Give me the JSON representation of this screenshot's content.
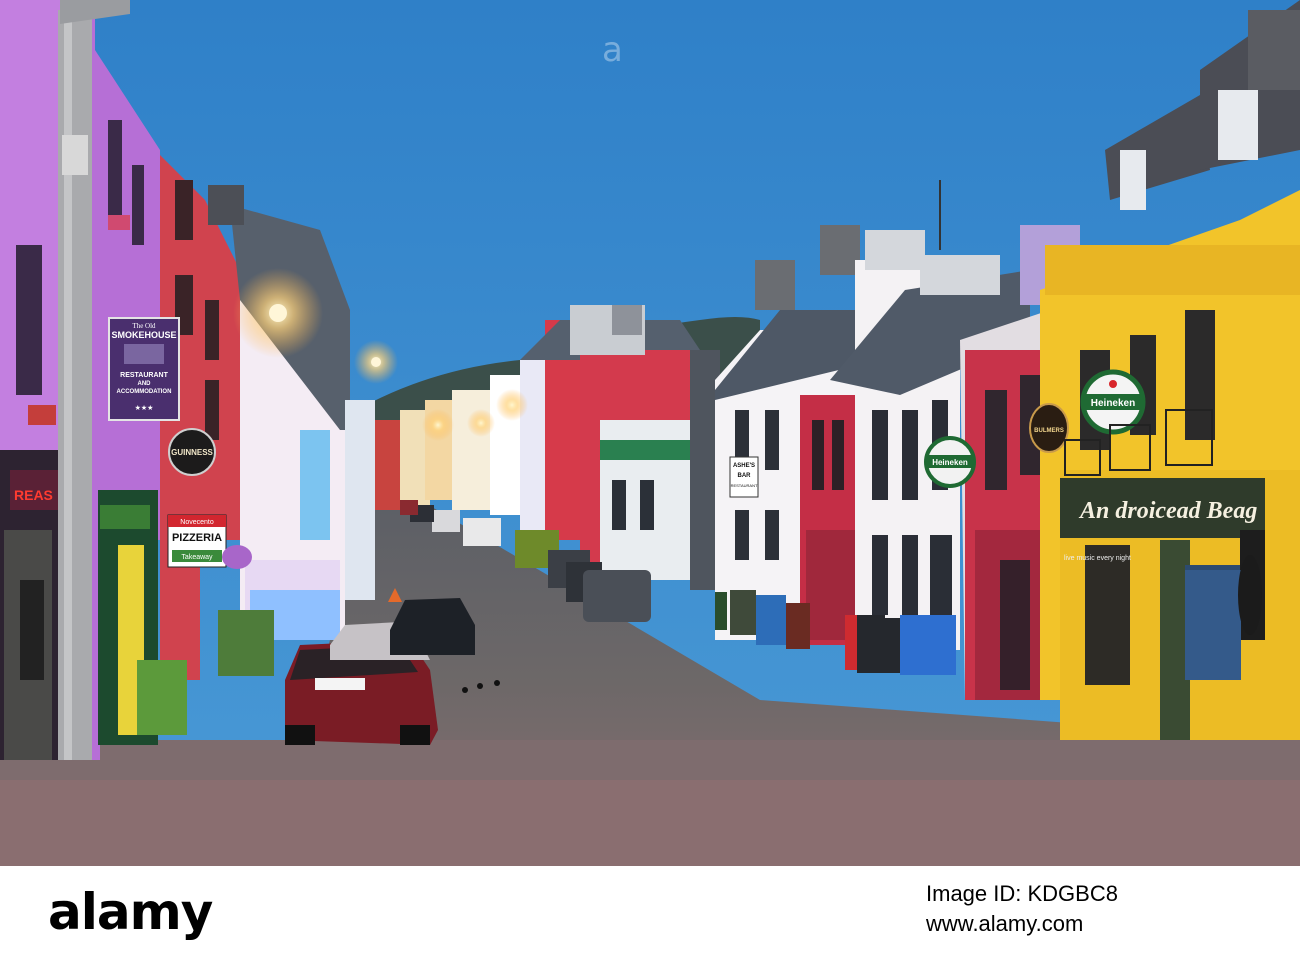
{
  "photo": {
    "subject": "Dingle Main Street",
    "colors": {
      "sky": "#3f8fd1",
      "road": "#6e6a6a",
      "yellow_pub": "#f0c229",
      "purple_building": "#b06ad0"
    }
  },
  "signs": {
    "smokehouse_top": "The Old",
    "smokehouse_name": "SMOKEHOUSE",
    "smokehouse_line1": "RESTAURANT",
    "smokehouse_line2": "AND",
    "smokehouse_line3": "ACCOMMODATION",
    "smokehouse_stars": "★★★",
    "guinness": "GUINNESS",
    "novecento": "Novecento",
    "pizzeria": "PIZZERIA",
    "takeaway": "Takeaway",
    "ashes_1": "ASHE'S",
    "ashes_2": "BAR",
    "ashes_3": "RESTAURANT",
    "heineken_mid": "Heineken",
    "heineken_right": "Heineken",
    "bulmers": "BULMERS",
    "pub_name": "An droicead Beag",
    "live_music": "live music every night"
  },
  "watermark": {
    "logo": "alamy",
    "image_id": "Image ID: KDGBC8",
    "url": "www.alamy.com"
  }
}
